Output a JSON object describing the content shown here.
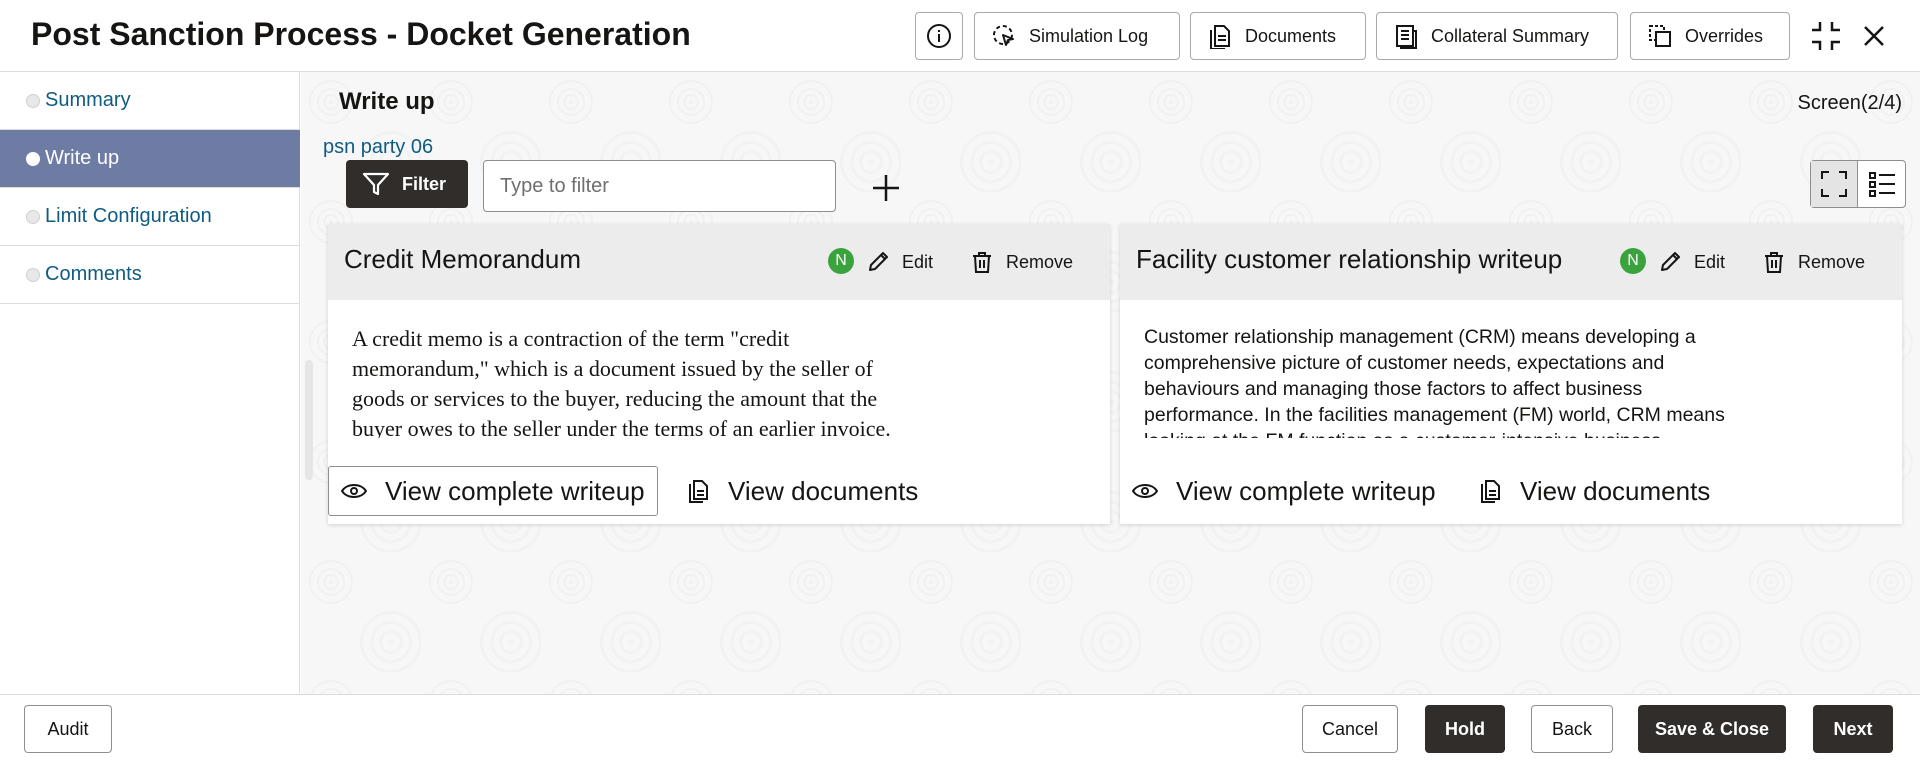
{
  "header": {
    "title": "Post Sanction Process - Docket Generation",
    "buttons": {
      "simulation_log": "Simulation Log",
      "documents": "Documents",
      "collateral_summary": "Collateral Summary",
      "overrides": "Overrides"
    },
    "icons": [
      "info-icon",
      "minimize-icon",
      "close-icon"
    ]
  },
  "sidebar": {
    "items": [
      {
        "label": "Summary",
        "active": false
      },
      {
        "label": "Write up",
        "active": true
      },
      {
        "label": "Limit Configuration",
        "active": false
      },
      {
        "label": "Comments",
        "active": false
      }
    ]
  },
  "main": {
    "section_title": "Write up",
    "screen_indicator": "Screen(2/4)",
    "party_name": "psn party 06",
    "filter_label": "Filter",
    "filter_placeholder": "Type to filter",
    "cards": [
      {
        "title": "Credit Memorandum",
        "badge": "N",
        "edit_label": "Edit",
        "remove_label": "Remove",
        "body": "A credit memo is a contraction of the term \"credit memorandum,\" which is a document issued by the seller of goods or services to the buyer, reducing the amount that the buyer owes to the seller under the terms of an earlier invoice. The credit memo usually includes details",
        "view_writeup_label": "View complete writeup",
        "view_documents_label": "View documents"
      },
      {
        "title": "Facility customer relationship writeup",
        "badge": "N",
        "edit_label": "Edit",
        "remove_label": "Remove",
        "body": "Customer relationship management (CRM) means developing a comprehensive picture of customer needs, expectations and behaviours and managing those factors to affect business performance. In the facilities management (FM) world, CRM means looking at the FM function as a customer-intensive business function instead of merely a facilities",
        "view_writeup_label": "View complete writeup",
        "view_documents_label": "View documents"
      }
    ]
  },
  "footer": {
    "audit": "Audit",
    "cancel": "Cancel",
    "hold": "Hold",
    "back": "Back",
    "save_close": "Save & Close",
    "next": "Next"
  },
  "colors": {
    "primary_dark": "#312d2a",
    "active_nav": "#6e7ba3",
    "link": "#0f5b82",
    "badge_green": "#3aa33e"
  }
}
